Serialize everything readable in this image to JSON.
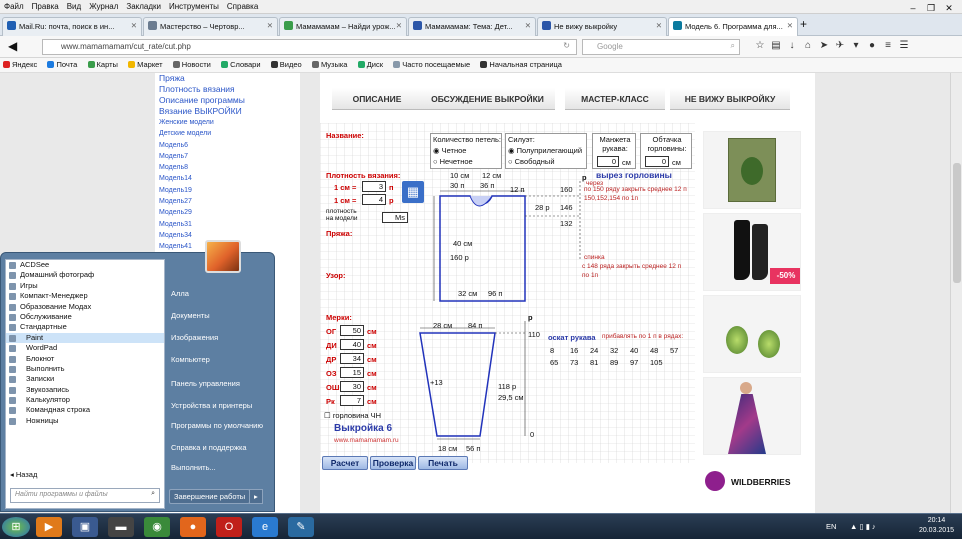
{
  "menu": [
    "Файл",
    "Правка",
    "Вид",
    "Журнал",
    "Закладки",
    "Инструменты",
    "Справка"
  ],
  "tabs": [
    {
      "label": "Mail.Ru: почта, поиск в ин...",
      "color": "#1f5fb3"
    },
    {
      "label": "Мастерство – Чертовр...",
      "color": "#6b7c90"
    },
    {
      "label": "Мамамамам – Найди урож...",
      "color": "#3a9d4b"
    },
    {
      "label": "Мамамамам: Тема: Дет...",
      "color": "#2b56a8"
    },
    {
      "label": "Не вижу выкройку",
      "color": "#2b56a8"
    },
    {
      "label": "Модель 6. Программа для...",
      "color": "#0b7a9e"
    }
  ],
  "url": "www.mamamamam/cut_rate/cut.php",
  "search_placeholder": "Google",
  "bookmarks": [
    "Яндекс",
    "Почта",
    "Карты",
    "Маркет",
    "Новости",
    "Словари",
    "Видео",
    "Музыка",
    "Диск",
    "Часто посещаемые",
    "Начальная страница"
  ],
  "sidebar": {
    "items": [
      "Пряжа",
      "Плотность вязания",
      "Описание программы",
      "Вязание ВЫКРОЙКИ"
    ],
    "small": [
      "Женские модели",
      "Детские модели",
      "Модель6",
      "Модель7",
      "Модель8",
      "Модель14",
      "Модель19",
      "Модель27",
      "Модель29",
      "Модель31",
      "Модель34",
      "Модель41"
    ]
  },
  "top_nav": [
    "ОПИСАНИЕ",
    "ОБСУЖДЕНИЕ ВЫКРОЙКИ",
    "МАСТЕР-КЛАСС",
    "НЕ ВИЖУ ВЫКРОЙКУ"
  ],
  "form": {
    "name_label": "Название:",
    "density_label": "Плотность вязания:",
    "row1": "1 см =",
    "row1_val": "3",
    "row1_unit": "п",
    "row2": "1 см =",
    "row2_val": "4",
    "row2_unit": "р",
    "density_model": "плотность на модели",
    "model_note": "Ms",
    "yarn_label": "Пряжа:",
    "pattern_label": "Узор:",
    "loops_label": "Количество петель:",
    "opt_even": "Четное",
    "opt_odd": "Нечетное",
    "silhouette_label": "Силуэт:",
    "opt_semi": "Полуприлегающий",
    "opt_free": "Свободный",
    "cuff_label": "Манжета рукава:",
    "cuff_val": "0",
    "cuff_unit": "см",
    "neck_label": "Обтачка горловины:",
    "neck_val": "0",
    "neck_unit": "см",
    "neck_cut": "вырез горловины",
    "marks_label": "Мерки:",
    "measures": [
      {
        "name": "ОГ",
        "val": "50",
        "unit": "см"
      },
      {
        "name": "ДИ",
        "val": "40",
        "unit": "см"
      },
      {
        "name": "ДР",
        "val": "34",
        "unit": "см"
      },
      {
        "name": "ОЗ",
        "val": "15",
        "unit": "см"
      },
      {
        "name": "ОШ",
        "val": "30",
        "unit": "см"
      },
      {
        "name": "Рк",
        "val": "7",
        "unit": "см"
      }
    ],
    "neck_check": "горловина ЧН",
    "pattern_title": "Выкройка 6",
    "site": "www.mamamamam.ru",
    "buttons": [
      "Расчет",
      "Проверка",
      "Печать"
    ]
  },
  "diagram": {
    "t1": "10 см",
    "t2": "12 см",
    "t3": "30 п",
    "t4": "36 п",
    "t5": "12 п",
    "t6": "160",
    "t7": "28 р",
    "t8": "146",
    "t9": "132",
    "m1": "40 см",
    "m2": "160 р",
    "b1": "32 см",
    "b2": "96 п",
    "s1": "28 см",
    "s2": "84 п",
    "s3": "110",
    "s4": "+13",
    "s5": "118 р",
    "s6": "29,5 см",
    "s7": "18 см",
    "s8": "56 п",
    "s9": "0",
    "p1": "р",
    "p2": "р",
    "n1": "через",
    "n2": "по 150 ряду закрыть среднее 12 п",
    "n3": "150,152,154 по 1п",
    "n4": "спинка",
    "n5": "с 148 ряда закрыть среднее 12 п",
    "n6": "по 1п",
    "sleeve": "оскат рукава",
    "sleeve_note": "прибавлять по 1 п в рядах:",
    "sleeve_nums": [
      "8",
      "16",
      "24",
      "32",
      "40",
      "48",
      "57"
    ],
    "sleeve_nums2": [
      "65",
      "73",
      "81",
      "89",
      "97",
      "105"
    ]
  },
  "ads": {
    "badge": "-50%",
    "brand": "WILDBERRIES",
    "info": "i ✕"
  },
  "start_menu": {
    "left_items": [
      "ACDSee",
      "Домашний фотограф",
      "Игры",
      "Компакт-Менеджер",
      "Образование Модах",
      "Обслуживание",
      "Стандартные",
      "Paint",
      "WordPad",
      "Блокнот",
      "Выполнить",
      "Записки",
      "Звукозапись",
      "Калькулятор",
      "Командная строка",
      "Ножницы"
    ],
    "back": "Назад",
    "search_placeholder": "Найти программы и файлы",
    "right_items": [
      "Алла",
      "Документы",
      "Изображения",
      "Компьютер",
      "Панель управления",
      "Устройства и принтеры",
      "Программы по умолчанию",
      "Справка и поддержка",
      "Выполнить..."
    ],
    "shutdown": "Завершение работы"
  },
  "taskbar": {
    "lang": "EN",
    "time": "20:14",
    "date": "20.03.2015"
  }
}
